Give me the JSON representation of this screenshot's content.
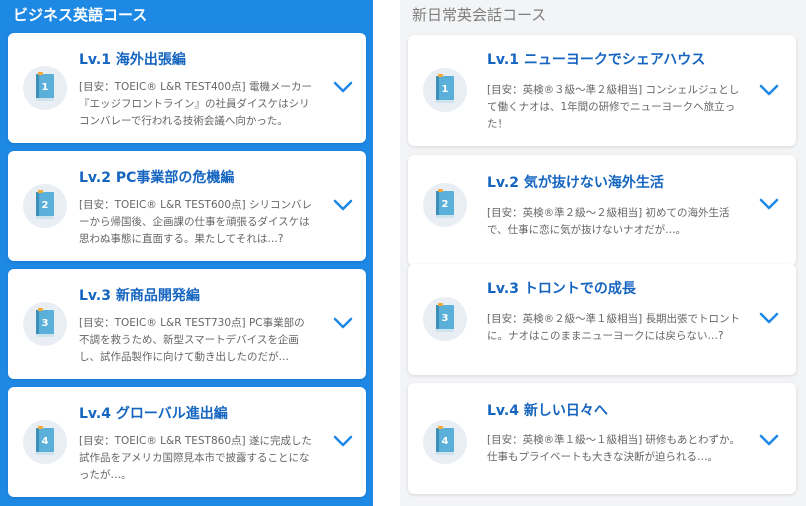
{
  "left": {
    "heading": "ビジネス英語コース",
    "items": [
      {
        "number": "1",
        "title": "Lv.1 海外出張編",
        "desc": "[目安：TOEIC® L&R TEST400点] 電機メーカー『エッジフロントライン』の社員ダイスケはシリコンバレーで行われる技術会議へ向かった。"
      },
      {
        "number": "2",
        "title": "Lv.2 PC事業部の危機編",
        "desc": "[目安：TOEIC® L&R TEST600点] シリコンバレーから帰国後、企画課の仕事を頑張るダイスケは思わぬ事態に直面する。果たしてそれは…?"
      },
      {
        "number": "3",
        "title": "Lv.3 新商品開発編",
        "desc": "[目安：TOEIC® L&R TEST730点] PC事業部の不調を救うため、新型スマートデバイスを企画し、試作品製作に向けて動き出したのだが…"
      },
      {
        "number": "4",
        "title": "Lv.4 グローバル進出編",
        "desc": "[目安：TOEIC® L&R TEST860点] 遂に完成した試作品をアメリカ国際見本市で披露することになったが…。"
      }
    ]
  },
  "right": {
    "heading": "新日常英会話コース",
    "items": [
      {
        "number": "1",
        "title": "Lv.1 ニューヨークでシェアハウス",
        "desc": "[目安：英検®３級～準２級相当] コンシェルジュとして働くナオは、1年間の研修でニューヨークへ旅立った！"
      },
      {
        "number": "2",
        "title": "Lv.2 気が抜けない海外生活",
        "desc": "[目安：英検®準２級～２級相当] 初めての海外生活で、仕事に恋に気が抜けないナオだが…。"
      },
      {
        "number": "3",
        "title": "Lv.3 トロントでの成長",
        "desc": "[目安：英検®２級～準１級相当] 長期出張でトロントに。ナオはこのままニューヨークには戻らない…?"
      },
      {
        "number": "4",
        "title": "Lv.4 新しい日々へ",
        "desc": "[目安：英検®準１級～１級相当] 研修もあとわずか。仕事もプライベートも大きな決断が迫られる…。"
      }
    ]
  },
  "colors": {
    "accent_blue": "#1e88e5",
    "title_blue": "#1565c0",
    "icon_blue": "#5ab0d8"
  }
}
